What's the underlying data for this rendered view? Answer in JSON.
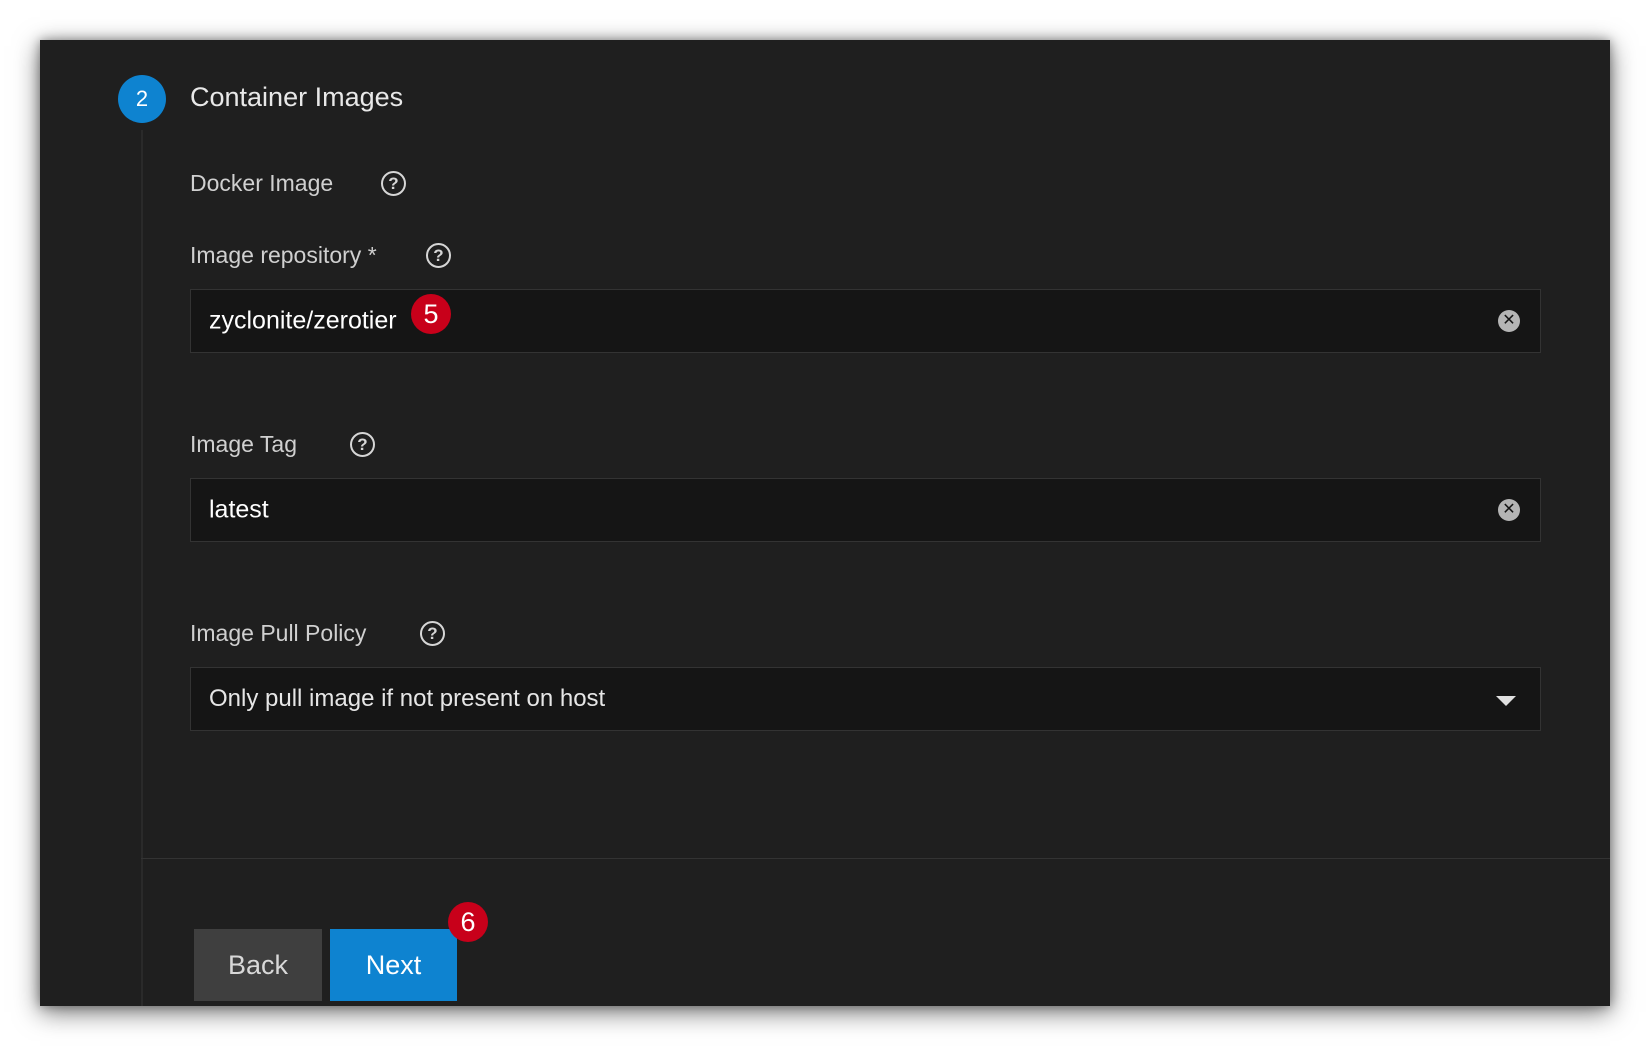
{
  "step": {
    "number": "2",
    "title": "Container Images"
  },
  "section": {
    "docker_image_label": "Docker Image"
  },
  "fields": {
    "repository": {
      "label": "Image repository *",
      "value": "zyclonite/zerotier"
    },
    "tag": {
      "label": "Image Tag",
      "value": "latest"
    },
    "pull_policy": {
      "label": "Image Pull Policy",
      "selected": "Only pull image if not present on host"
    }
  },
  "buttons": {
    "back": "Back",
    "next": "Next"
  },
  "annotations": {
    "badge_5": "5",
    "badge_6": "6"
  },
  "icons": {
    "help": "?",
    "clear": "✕"
  },
  "colors": {
    "accent": "#0e83d0",
    "badge": "#c8001a",
    "background": "#1f1f1f"
  }
}
